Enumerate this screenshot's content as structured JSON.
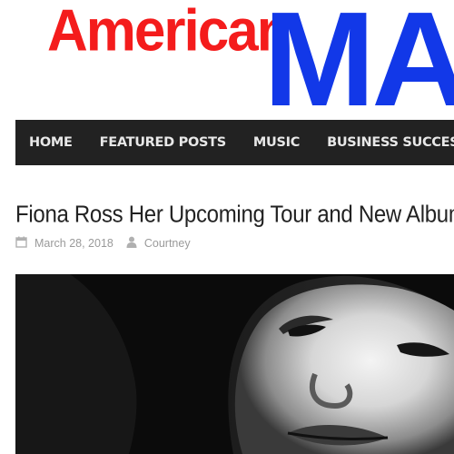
{
  "logo": {
    "part1": "American",
    "part2": "MAG"
  },
  "nav": {
    "items": [
      {
        "label": "HOME"
      },
      {
        "label": "FEATURED POSTS"
      },
      {
        "label": "MUSIC"
      },
      {
        "label": "BUSINESS SUCCESS"
      }
    ]
  },
  "post": {
    "title": "Fiona Ross Her Upcoming Tour and New Album",
    "date": "March 28, 2018",
    "author": "Courtney",
    "date_icon": "calendar-icon",
    "author_icon": "user-icon"
  },
  "colors": {
    "logo_red": "#f41c1c",
    "logo_blue": "#1238e8",
    "nav_bg": "#222222",
    "meta_gray": "#9a9a9a"
  }
}
